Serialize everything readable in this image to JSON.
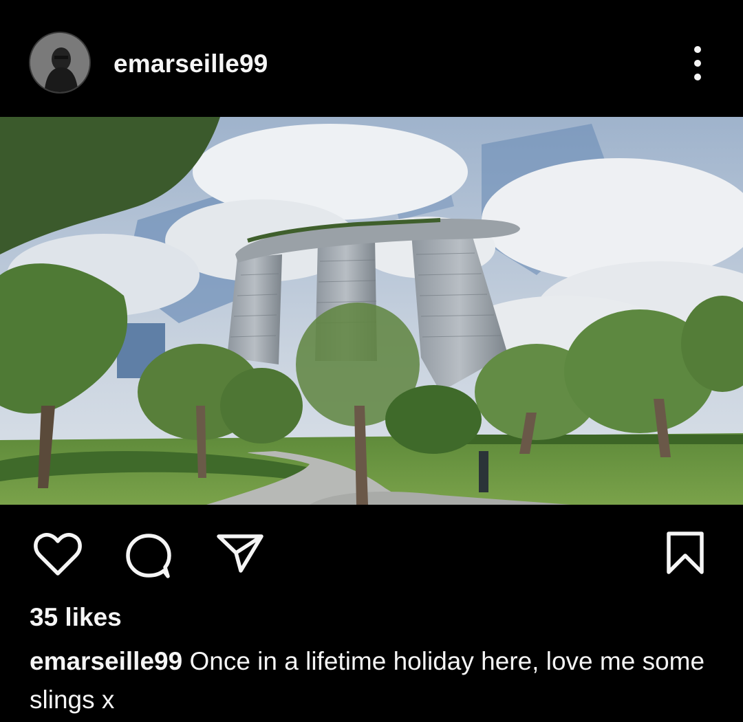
{
  "post": {
    "username": "emarseille99",
    "more_icon": "more-vertical-icon",
    "photo_alt": "Marina Bay Sands hotel viewed from a landscaped garden",
    "likes": "35 likes",
    "caption_username": "emarseille99",
    "caption_text": "Once in a lifetime holiday here, love me some slings x"
  },
  "actions": {
    "like_icon": "heart-icon",
    "comment_icon": "comment-icon",
    "share_icon": "send-icon",
    "save_icon": "bookmark-icon"
  },
  "colors": {
    "background": "#000000",
    "text": "#f5f5f5"
  }
}
